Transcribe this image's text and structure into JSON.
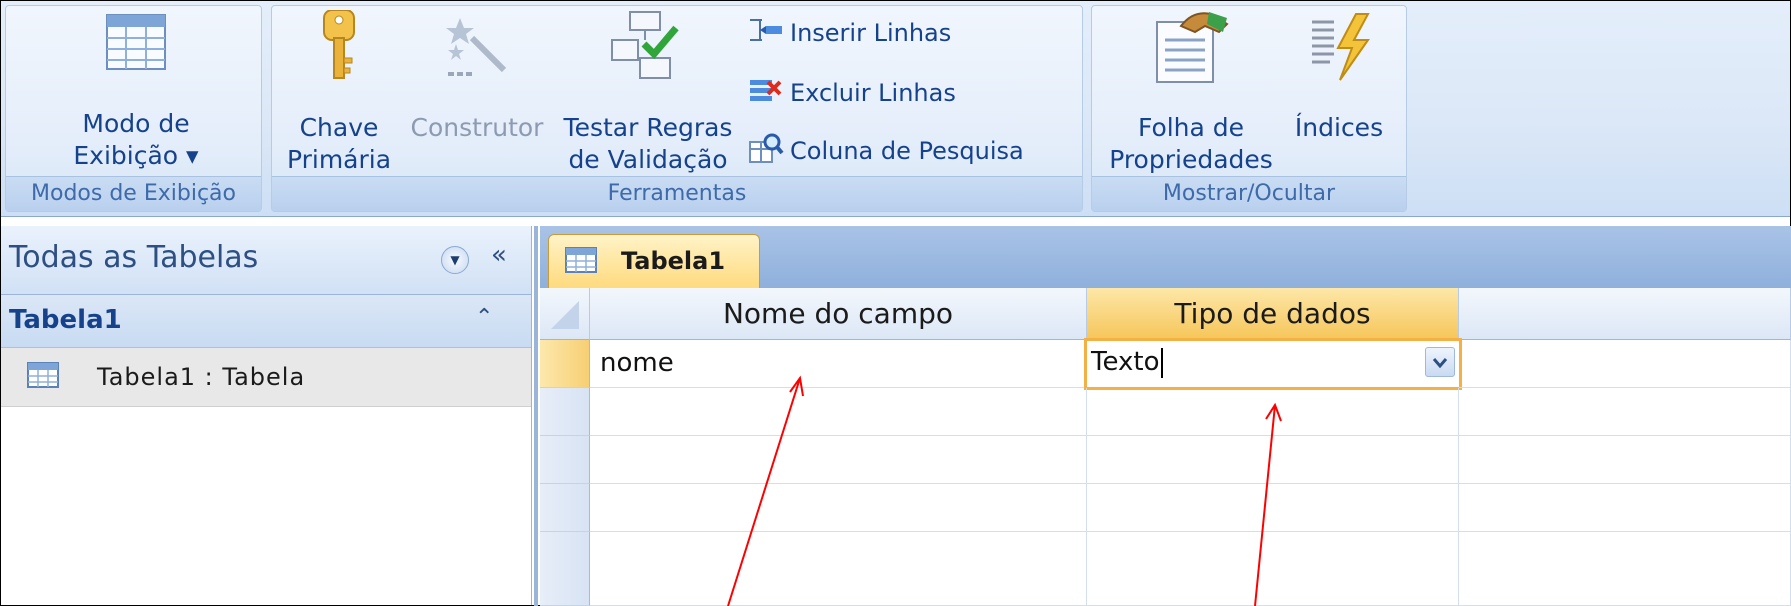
{
  "ribbon": {
    "groups": [
      {
        "label": "Modos de Exibição"
      },
      {
        "label": "Ferramentas"
      },
      {
        "label": "Mostrar/Ocultar"
      }
    ],
    "view_button": {
      "label": "Modo de\nExibição ▾"
    },
    "primary_key_button": {
      "label": "Chave\nPrimária"
    },
    "builder_button": {
      "label": "Construtor"
    },
    "test_rules_button": {
      "label": "Testar Regras\nde Validação"
    },
    "insert_rows": {
      "label": "Inserir Linhas"
    },
    "delete_rows": {
      "label": "Excluir Linhas"
    },
    "lookup_column": {
      "label": "Coluna de Pesquisa"
    },
    "property_sheet_button": {
      "label": "Folha de\nPropriedades"
    },
    "indexes_button": {
      "label": "Índices"
    }
  },
  "nav": {
    "title": "Todas as Tabelas",
    "collapse_glyph": "«",
    "group_title": "Tabela1",
    "group_chevron": "⌃",
    "item_label": "Tabela1 : Tabela"
  },
  "document": {
    "tab_label": "Tabela1",
    "columns": [
      "Nome do campo",
      "Tipo de dados"
    ],
    "rows": [
      {
        "field_name": "nome",
        "data_type": "Texto"
      }
    ]
  },
  "colors": {
    "ribbon_text": "#15428b",
    "active_accent": "#f4b045",
    "annotation_arrow": "#ff0000"
  }
}
